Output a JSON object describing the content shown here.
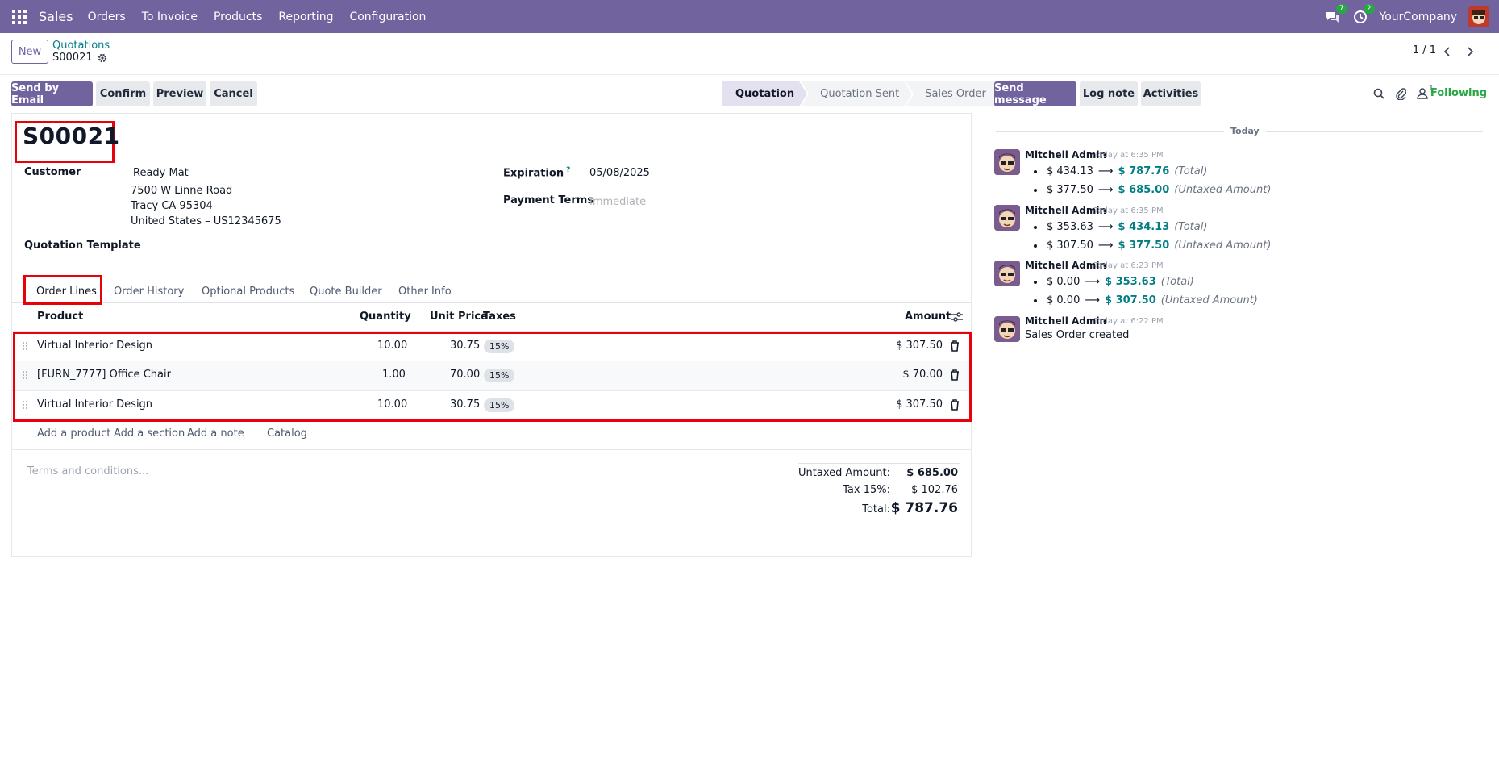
{
  "navbar": {
    "app_name": "Sales",
    "menus": [
      "Orders",
      "To Invoice",
      "Products",
      "Reporting",
      "Configuration"
    ],
    "messages_count": "7",
    "activities_count": "2",
    "company": "YourCompany"
  },
  "control_panel": {
    "new_label": "New",
    "breadcrumb_parent": "Quotations",
    "breadcrumb_current": "S00021",
    "pager": "1 / 1"
  },
  "actions": {
    "send_email": "Send by Email",
    "confirm": "Confirm",
    "preview": "Preview",
    "cancel": "Cancel"
  },
  "statusbar": [
    "Quotation",
    "Quotation Sent",
    "Sales Order"
  ],
  "form": {
    "title": "S00021",
    "customer_label": "Customer",
    "customer_name": "Ready Mat",
    "customer_address": [
      "7500 W Linne Road",
      "Tracy CA 95304",
      "United States – US12345675"
    ],
    "expiration_label": "Expiration",
    "expiration_help": "?",
    "expiration_value": "05/08/2025",
    "payment_terms_label": "Payment Terms",
    "payment_terms_placeholder": "Immediate",
    "template_label": "Quotation Template"
  },
  "tabs": [
    "Order Lines",
    "Order History",
    "Optional Products",
    "Quote Builder",
    "Other Info"
  ],
  "table": {
    "headers": {
      "product": "Product",
      "quantity": "Quantity",
      "unit_price": "Unit Price",
      "taxes": "Taxes",
      "amount": "Amount"
    },
    "rows": [
      {
        "product": "Virtual Interior Design",
        "quantity": "10.00",
        "unit_price": "30.75",
        "tax": "15%",
        "amount": "$ 307.50"
      },
      {
        "product": "[FURN_7777] Office Chair",
        "quantity": "1.00",
        "unit_price": "70.00",
        "tax": "15%",
        "amount": "$ 70.00"
      },
      {
        "product": "Virtual Interior Design",
        "quantity": "10.00",
        "unit_price": "30.75",
        "tax": "15%",
        "amount": "$ 307.50"
      }
    ],
    "add_product": "Add a product",
    "add_section": "Add a section",
    "add_note": "Add a note",
    "catalog": "Catalog"
  },
  "terms_placeholder": "Terms and conditions...",
  "totals": {
    "untaxed_label": "Untaxed Amount:",
    "untaxed_value": "$ 685.00",
    "tax_label": "Tax 15%:",
    "tax_value": "$ 102.76",
    "total_label": "Total:",
    "total_value": "$ 787.76"
  },
  "chatter": {
    "send_message": "Send message",
    "log_note": "Log note",
    "activities": "Activities",
    "followers_count": "1",
    "following": "Following",
    "today": "Today",
    "messages": [
      {
        "author": "Mitchell Admin",
        "time": "Today at 6:35 PM",
        "changes": [
          {
            "old": "$ 434.13",
            "new": "$ 787.76",
            "field": "(Total)"
          },
          {
            "old": "$ 377.50",
            "new": "$ 685.00",
            "field": "(Untaxed Amount)"
          }
        ]
      },
      {
        "author": "Mitchell Admin",
        "time": "Today at 6:35 PM",
        "changes": [
          {
            "old": "$ 353.63",
            "new": "$ 434.13",
            "field": "(Total)"
          },
          {
            "old": "$ 307.50",
            "new": "$ 377.50",
            "field": "(Untaxed Amount)"
          }
        ]
      },
      {
        "author": "Mitchell Admin",
        "time": "Today at 6:23 PM",
        "changes": [
          {
            "old": "$ 0.00",
            "new": "$ 353.63",
            "field": "(Total)"
          },
          {
            "old": "$ 0.00",
            "new": "$ 307.50",
            "field": "(Untaxed Amount)"
          }
        ]
      },
      {
        "author": "Mitchell Admin",
        "time": "Today at 6:22 PM",
        "body": "Sales Order created"
      }
    ]
  },
  "colors": {
    "brand": "#71639e",
    "link": "#017e84",
    "highlight": "#e8000b",
    "following": "#28a745"
  }
}
